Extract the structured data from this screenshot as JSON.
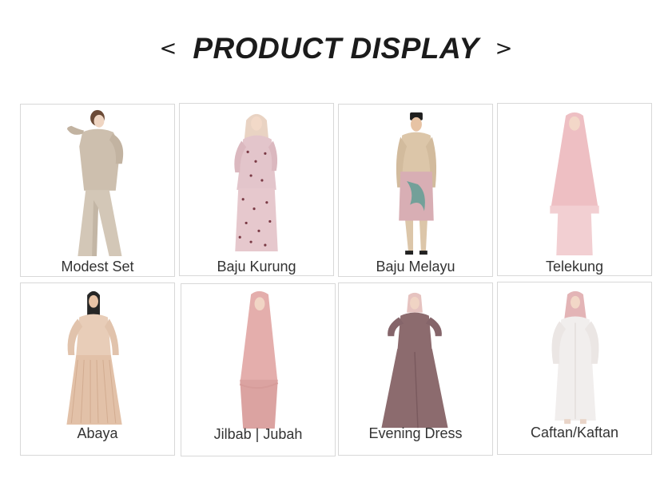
{
  "header": {
    "title": "PRODUCT DISPLAY",
    "prev_arrow": "<",
    "next_arrow": ">"
  },
  "products": [
    {
      "label": "Modest Set",
      "icon": "modest-set-image",
      "colors": {
        "primary": "#cdbfae",
        "accent": "#b8a896"
      }
    },
    {
      "label": "Baju Kurung",
      "icon": "baju-kurung-image",
      "colors": {
        "primary": "#e3c5cb",
        "accent": "#7a3a45"
      }
    },
    {
      "label": "Baju Melayu",
      "icon": "baju-melayu-image",
      "colors": {
        "primary": "#dcc6a9",
        "accent": "#d8aeb4"
      }
    },
    {
      "label": "Telekung",
      "icon": "telekung-image",
      "colors": {
        "primary": "#eebfc3",
        "accent": "#f2cfd2"
      }
    },
    {
      "label": "Abaya",
      "icon": "abaya-image",
      "colors": {
        "primary": "#e8cdb8",
        "accent": "#d9b69c"
      }
    },
    {
      "label": "Jilbab | Jubah",
      "icon": "jilbab-jubah-image",
      "colors": {
        "primary": "#e4aeac",
        "accent": "#d69c9a"
      }
    },
    {
      "label": "Evening Dress",
      "icon": "evening-dress-image",
      "colors": {
        "primary": "#8c6b6e",
        "accent": "#e6c3c0"
      }
    },
    {
      "label": "Caftan/Kaftan",
      "icon": "caftan-kaftan-image",
      "colors": {
        "primary": "#f1eeed",
        "accent": "#e3b4b6"
      }
    }
  ]
}
